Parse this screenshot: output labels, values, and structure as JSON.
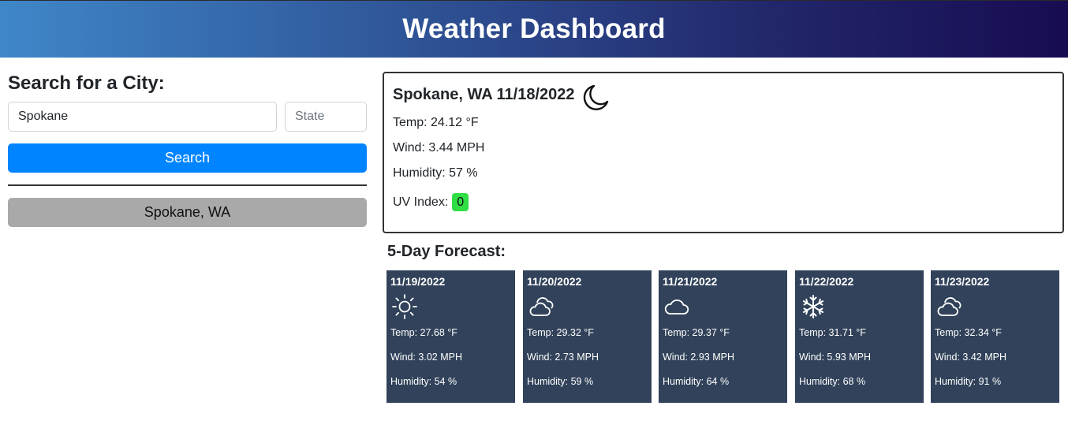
{
  "header": {
    "title": "Weather Dashboard"
  },
  "search": {
    "heading": "Search for a City:",
    "city_value": "Spokane",
    "state_placeholder": "State",
    "button_label": "Search"
  },
  "history": [
    "Spokane, WA"
  ],
  "current": {
    "title": "Spokane, WA 11/18/2022",
    "icon": "moon-icon",
    "temp": "Temp: 24.12 °F",
    "wind": "Wind: 3.44 MPH",
    "humidity": "Humidity: 57 %",
    "uv_label": "UV Index:",
    "uv_value": "0",
    "uv_color": "#2fdd44"
  },
  "forecast": {
    "heading": "5-Day Forecast:",
    "card_color": "#31425a",
    "days": [
      {
        "date": "11/19/2022",
        "icon": "sun-icon",
        "temp": "Temp: 27.68 °F",
        "wind": "Wind: 3.02 MPH",
        "humidity": "Humidity: 54 %"
      },
      {
        "date": "11/20/2022",
        "icon": "cloudy-icon",
        "temp": "Temp: 29.32 °F",
        "wind": "Wind: 2.73 MPH",
        "humidity": "Humidity: 59 %"
      },
      {
        "date": "11/21/2022",
        "icon": "cloud-icon",
        "temp": "Temp: 29.37 °F",
        "wind": "Wind: 2.93 MPH",
        "humidity": "Humidity: 64 %"
      },
      {
        "date": "11/22/2022",
        "icon": "snowflake-icon",
        "temp": "Temp: 31.71 °F",
        "wind": "Wind: 5.93 MPH",
        "humidity": "Humidity: 68 %"
      },
      {
        "date": "11/23/2022",
        "icon": "cloudy-icon",
        "temp": "Temp: 32.34 °F",
        "wind": "Wind: 3.42 MPH",
        "humidity": "Humidity: 91 %"
      }
    ]
  },
  "colors": {
    "search_button": "#0084ff",
    "history_button": "#a9a9a9"
  }
}
